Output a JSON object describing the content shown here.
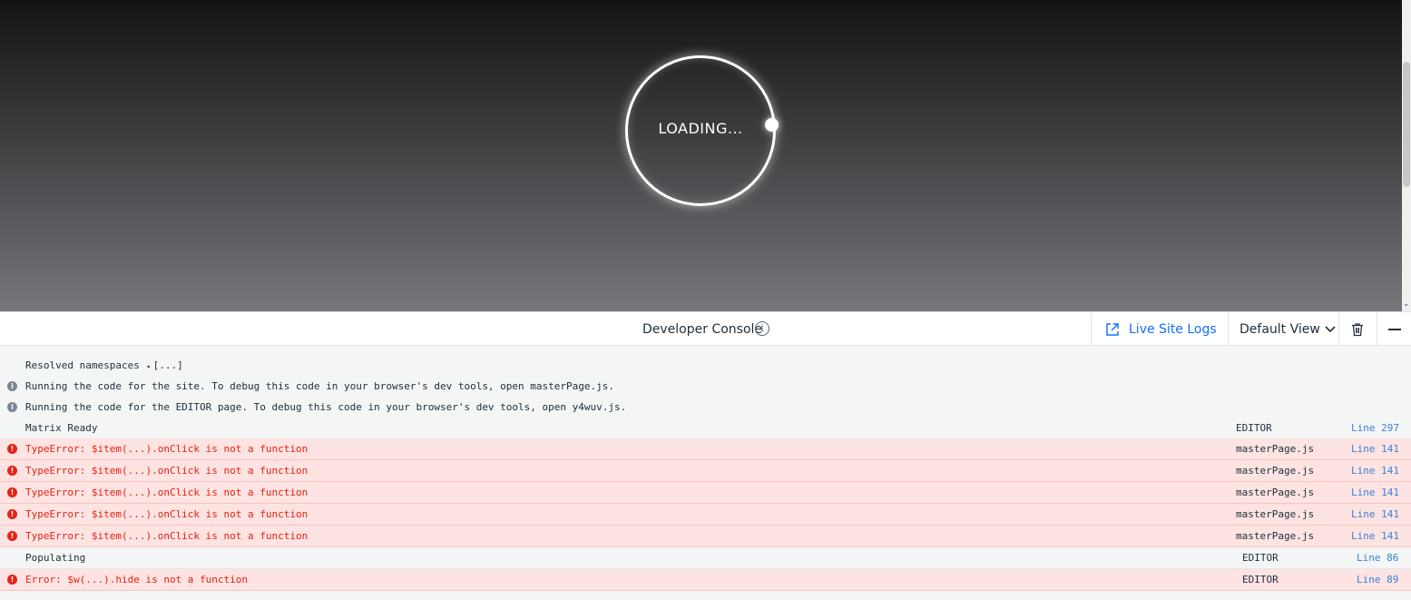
{
  "preview": {
    "loading_text": "LOADING..."
  },
  "console": {
    "title": "Developer Console",
    "info_icon_glyph": "i",
    "live_site_logs_label": "Live Site Logs",
    "view_selector_label": "Default View"
  },
  "colors": {
    "accent_blue": "#116dff",
    "error_red": "#e62214",
    "error_row_bg": "#fde3e1",
    "line_link": "#3d7fd8"
  },
  "logs": [
    {
      "level": "log",
      "message": "Resolved namespaces",
      "expander": "[...]",
      "source": "",
      "line": ""
    },
    {
      "level": "info",
      "message": "Running the code for the site. To debug this code in your browser's dev tools, open masterPage.js.",
      "source": "",
      "line": ""
    },
    {
      "level": "info",
      "message": "Running the code for the EDITOR page. To debug this code in your browser's dev tools, open y4wuv.js.",
      "source": "",
      "line": ""
    },
    {
      "level": "log",
      "message": "Matrix Ready",
      "source": "EDITOR",
      "line": "Line 297"
    },
    {
      "level": "error",
      "message": "TypeError: $item(...).onClick is not a function",
      "source": "masterPage.js",
      "line": "Line 141"
    },
    {
      "level": "error",
      "message": "TypeError: $item(...).onClick is not a function",
      "source": "masterPage.js",
      "line": "Line 141"
    },
    {
      "level": "error",
      "message": "TypeError: $item(...).onClick is not a function",
      "source": "masterPage.js",
      "line": "Line 141"
    },
    {
      "level": "error",
      "message": "TypeError: $item(...).onClick is not a function",
      "source": "masterPage.js",
      "line": "Line 141"
    },
    {
      "level": "error",
      "message": "TypeError: $item(...).onClick is not a function",
      "source": "masterPage.js",
      "line": "Line 141"
    },
    {
      "level": "log",
      "message": "Populating",
      "source": "EDITOR",
      "line": "Line 86"
    },
    {
      "level": "error",
      "message": "Error: $w(...).hide is not a function",
      "source": "EDITOR",
      "line": "Line 89"
    }
  ]
}
